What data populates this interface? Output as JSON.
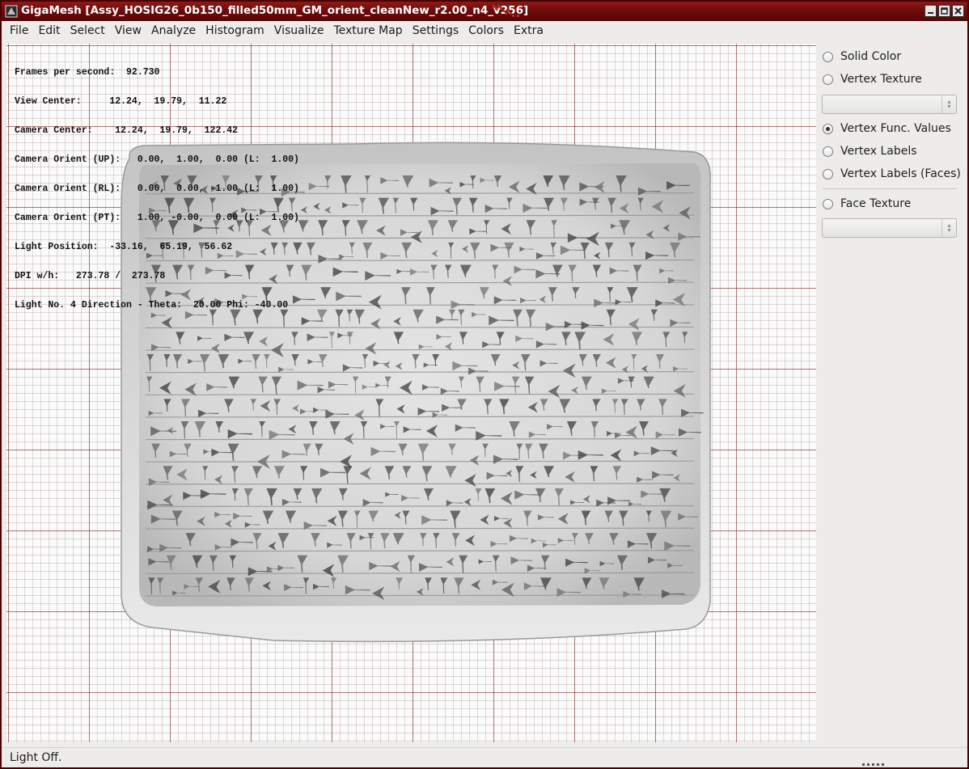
{
  "window": {
    "title": "GigaMesh [Assy_HOSIG26_0b150_filled50mm_GM_orient_cleanNew_r2.00_n4_v256]"
  },
  "menu": [
    "File",
    "Edit",
    "Select",
    "View",
    "Analyze",
    "Histogram",
    "Visualize",
    "Texture Map",
    "Settings",
    "Colors",
    "Extra"
  ],
  "overlay": {
    "lines": [
      "Frames per second:  92.730",
      "View Center:     12.24,  19.79,  11.22",
      "Camera Center:    12.24,  19.79,  122.42",
      "Camera Orient (UP):   0.00,  1.00,  0.00 (L:  1.00)",
      "Camera Orient (RL):   0.00,  0.00, -1.00 (L:  1.00)",
      "Camera Orient (PT):   1.00, -0.00,  0.00 (L:  1.00)",
      "Light Position:  -33.16,  65.19,  56.62",
      "DPI w/h:   273.78 /  273.78",
      "Light No. 4 Direction - Theta:  20.00 Phi: -40.00"
    ]
  },
  "panel": {
    "options": [
      {
        "label": "Solid Color",
        "checked": false
      },
      {
        "label": "Vertex Texture",
        "checked": false
      },
      {
        "label": "Vertex Func. Values",
        "checked": true
      },
      {
        "label": "Vertex Labels",
        "checked": false
      },
      {
        "label": "Vertex Labels (Faces)",
        "checked": false
      },
      {
        "label": "Face Texture",
        "checked": false
      }
    ],
    "vertex_texture_select": "",
    "face_texture_select": ""
  },
  "status": {
    "text": "Light Off."
  },
  "colors": {
    "titlebar": "#6d0a0a",
    "grid_major": "#802828",
    "tablet_surface": "#d9d9d9"
  },
  "icons": {
    "app": "gigamesh-app-icon",
    "minimize": "minimize-icon",
    "maximize": "maximize-icon",
    "close": "close-icon"
  }
}
